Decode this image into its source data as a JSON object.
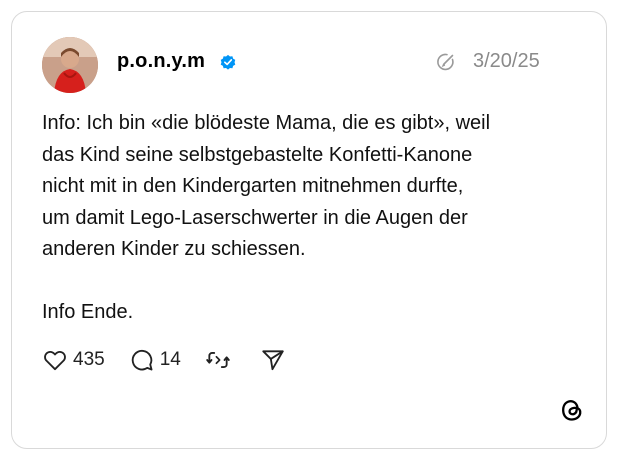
{
  "post": {
    "username": "p.o.n.y.m",
    "date": "3/20/25",
    "text": "Info: Ich bin «die blödeste Mama, die es gibt», weil\ndas Kind seine selbstgebastelte Konfetti-Kanone\nnicht mit in den Kindergarten mitnehmen durfte,\num damit Lego-Laserschwerter in die Augen der\nanderen Kinder zu schiessen.\n\nInfo Ende.",
    "likes": "435",
    "replies": "14"
  },
  "icons": {
    "avatar": "profile-photo",
    "verified": "verified-badge-icon",
    "edited": "edited-icon",
    "like": "heart-icon",
    "reply": "comment-icon",
    "repost": "repost-icon",
    "share": "send-icon",
    "brand": "threads-logo"
  },
  "colors": {
    "verified_badge": "#0095f6",
    "date_text": "#8a8a8a",
    "border": "#d9d9d9"
  }
}
